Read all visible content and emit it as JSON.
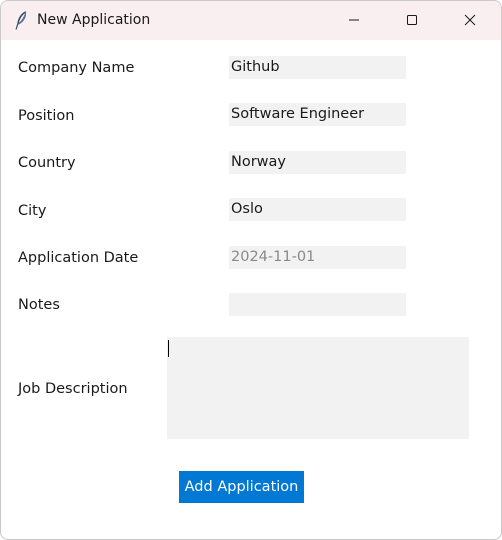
{
  "window": {
    "title": "New Application",
    "icon": "feather-icon",
    "controls": {
      "minimize_icon": "minimize-icon",
      "maximize_icon": "maximize-icon",
      "close_icon": "close-icon"
    }
  },
  "form": {
    "company_name": {
      "label": "Company Name",
      "value": "Github"
    },
    "position": {
      "label": "Position",
      "value": "Software Engineer"
    },
    "country": {
      "label": "Country",
      "value": "Norway"
    },
    "city": {
      "label": "City",
      "value": "Oslo"
    },
    "application_date": {
      "label": "Application Date",
      "value": "2024-11-01",
      "disabled": true
    },
    "notes": {
      "label": "Notes",
      "value": ""
    },
    "job_description": {
      "label": "Job Description",
      "value": ""
    }
  },
  "actions": {
    "submit_label": "Add Application"
  },
  "colors": {
    "titlebar_bg": "#f9eff1",
    "field_bg": "#f2f2f3",
    "button_bg": "#0078d4",
    "button_text": "#ffffff",
    "disabled_text": "#8a8a8a"
  }
}
